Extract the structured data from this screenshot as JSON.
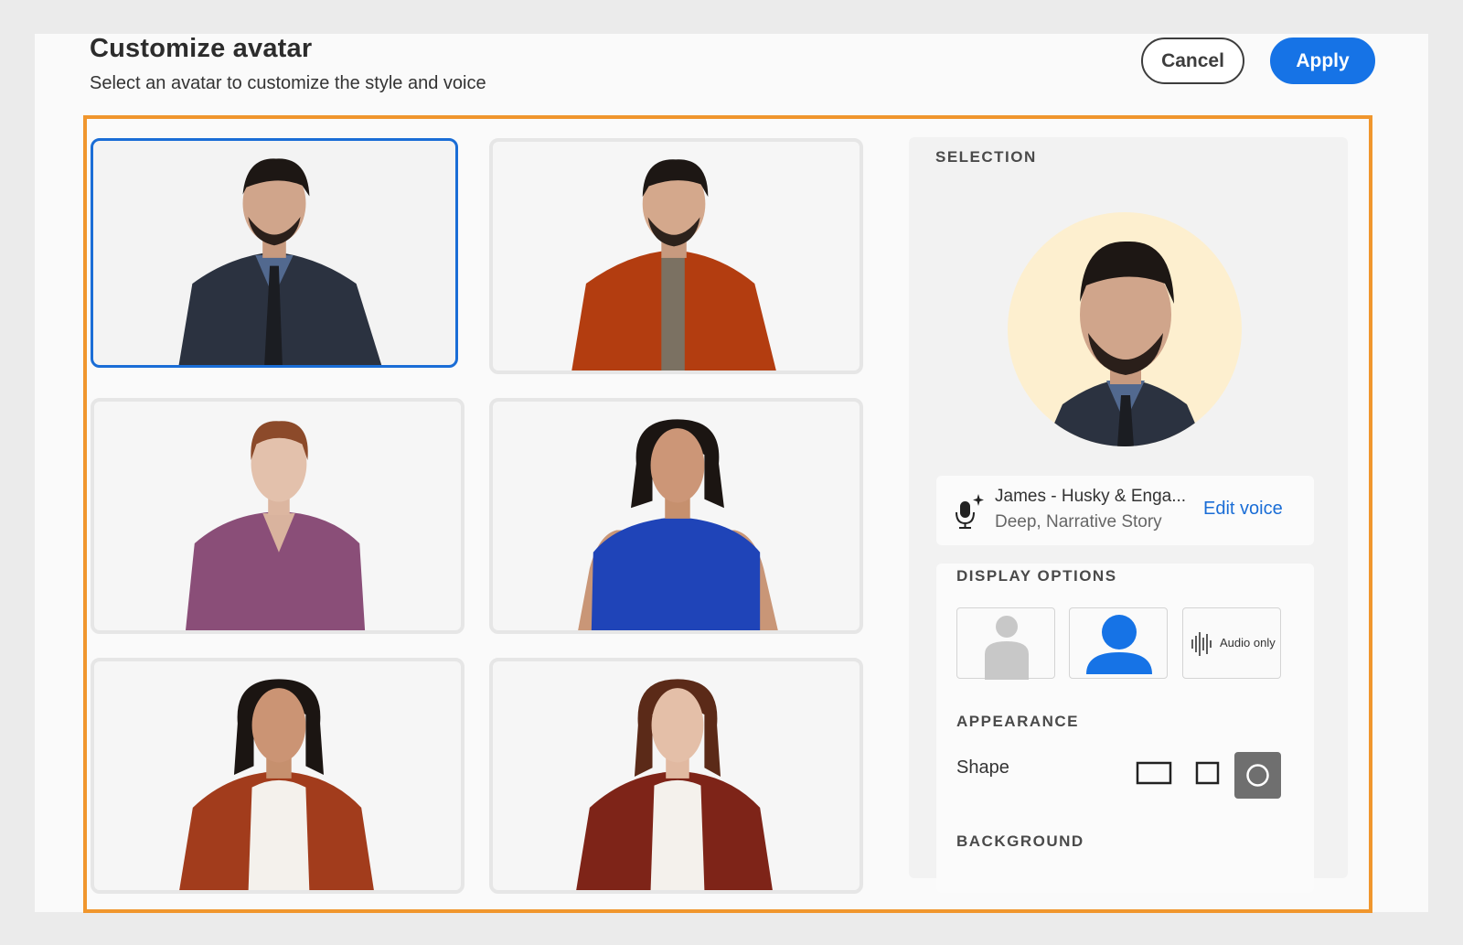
{
  "header": {
    "title": "Customize avatar",
    "subtitle": "Select an avatar to customize the style and voice",
    "cancel_label": "Cancel",
    "apply_label": "Apply"
  },
  "avatars": [
    {
      "id": "man-suit",
      "selected": true
    },
    {
      "id": "man-orange-shirt",
      "selected": false
    },
    {
      "id": "woman-purple-blouse",
      "selected": false
    },
    {
      "id": "woman-blue-top",
      "selected": false
    },
    {
      "id": "woman-rust-cardigan",
      "selected": false
    },
    {
      "id": "woman-red-blazer",
      "selected": false
    }
  ],
  "panel": {
    "selection_label": "SELECTION",
    "voice": {
      "name": "James - Husky & Enga...",
      "description": "Deep, Narrative Story",
      "edit_label": "Edit voice"
    },
    "display_options_label": "DISPLAY OPTIONS",
    "display_options": [
      {
        "name": "avatar-silhouette-icon",
        "active": false
      },
      {
        "name": "avatar-person-icon",
        "active": true
      },
      {
        "name": "audio-only",
        "label": "Audio only",
        "active": false
      }
    ],
    "appearance_label": "APPEARANCE",
    "shape_label": "Shape",
    "shapes": [
      "rectangle",
      "square",
      "circle"
    ],
    "selected_shape": "circle",
    "background_label": "BACKGROUND"
  },
  "colors": {
    "accent": "#1673e6",
    "highlight": "#f0962d",
    "selection_bg": "#fdefcf"
  }
}
